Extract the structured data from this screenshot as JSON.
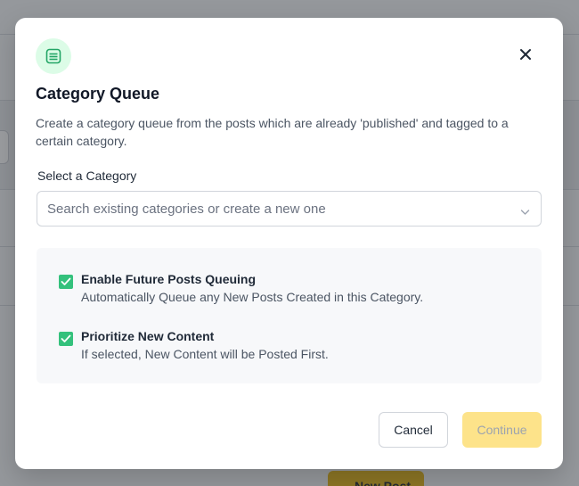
{
  "modal": {
    "icon": "queue-list-icon",
    "close_icon": "close-icon",
    "title": "Category Queue",
    "description": "Create a category queue from the posts which are already 'published' and tagged to a certain category."
  },
  "category_field": {
    "label": "Select a Category",
    "placeholder": "Search existing categories or create a new one",
    "value": ""
  },
  "options": [
    {
      "title": "Enable Future Posts Queuing",
      "description": "Automatically Queue any New Posts Created in this Category.",
      "checked": true
    },
    {
      "title": "Prioritize New Content",
      "description": "If selected, New Content will be Posted First.",
      "checked": true
    }
  ],
  "actions": {
    "cancel_label": "Cancel",
    "continue_label": "Continue"
  },
  "background": {
    "partial_button_label": "New Post"
  },
  "colors": {
    "accent_green": "#34c17c",
    "continue_disabled": "#fde38a",
    "icon_bg": "#dcfce7"
  }
}
